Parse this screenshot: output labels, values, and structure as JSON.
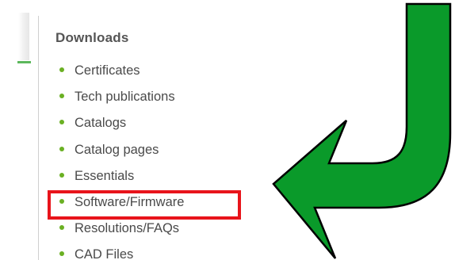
{
  "sidebar": {
    "heading": "Downloads",
    "items": [
      {
        "label": "Certificates"
      },
      {
        "label": "Tech publications"
      },
      {
        "label": "Catalogs"
      },
      {
        "label": "Catalog pages"
      },
      {
        "label": "Essentials"
      },
      {
        "label": "Software/Firmware"
      },
      {
        "label": "Resolutions/FAQs"
      },
      {
        "label": "CAD Files"
      }
    ]
  },
  "annotation": {
    "highlighted_item": "Software/Firmware",
    "highlight_color": "#e8141b",
    "arrow_color": "#0a9a2a",
    "arrow_icon": "curved-arrow-down-left"
  },
  "colors": {
    "bullet": "#6ab023",
    "text": "#4a4a4a",
    "heading": "#555555"
  }
}
